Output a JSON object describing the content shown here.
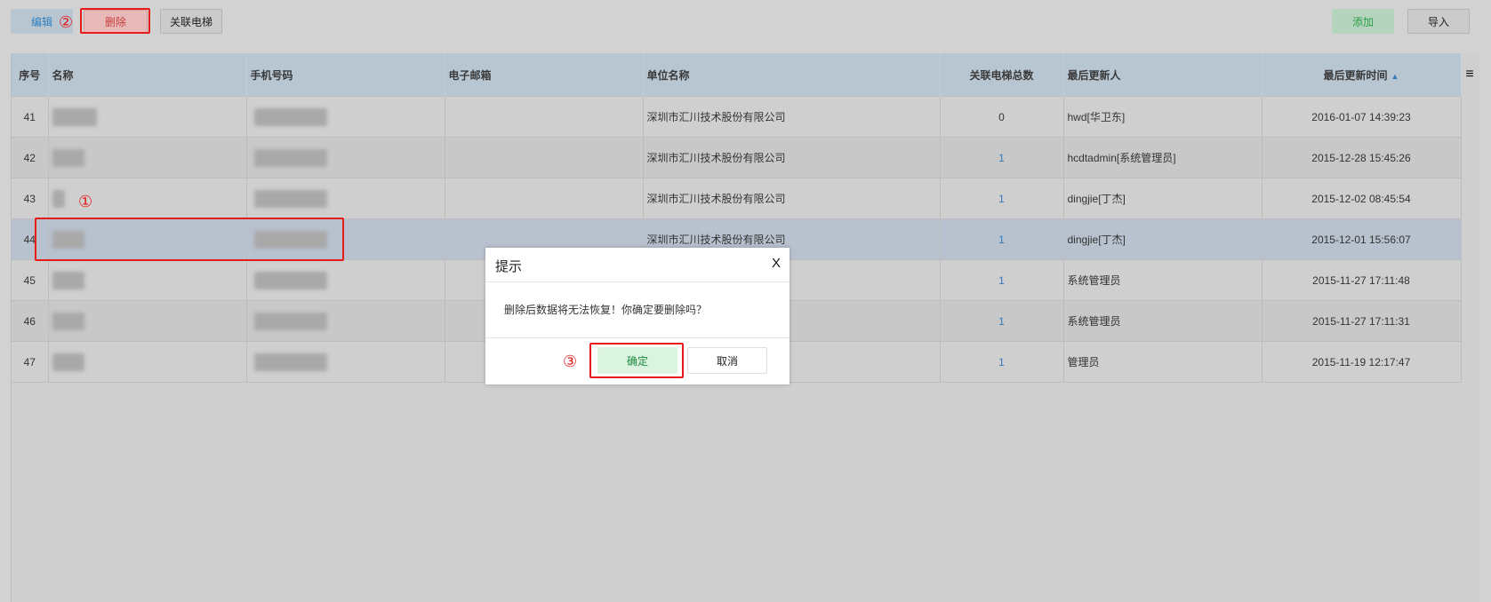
{
  "toolbar": {
    "edit_label": "编辑",
    "delete_label": "删除",
    "link_elevator_label": "关联电梯",
    "add_label": "添加",
    "import_label": "导入"
  },
  "colors": {
    "header_bg": "#b8c6d2",
    "link_blue": "#2f7bbd",
    "annotation_red": "#e81b1b",
    "confirm_green": "#1e8a3c"
  },
  "annotations": {
    "step1": "①",
    "step2": "②",
    "step3": "③"
  },
  "table": {
    "headers": {
      "index": "序号",
      "name": "名称",
      "phone": "手机号码",
      "email": "电子邮箱",
      "company": "单位名称",
      "elevator_count": "关联电梯总数",
      "last_updater": "最后更新人",
      "last_updated": "最后更新时间"
    },
    "sort_icon": "sort-icon",
    "rows": [
      {
        "index": "41",
        "email": "",
        "company": "深圳市汇川技术股份有限公司",
        "elevator_count": "0",
        "last_updater": "hwd[华卫东]",
        "last_updated": "2016-01-07 14:39:23"
      },
      {
        "index": "42",
        "email": "",
        "company": "深圳市汇川技术股份有限公司",
        "elevator_count": "1",
        "last_updater": "hcdtadmin[系统管理员]",
        "last_updated": "2015-12-28 15:45:26"
      },
      {
        "index": "43",
        "email": "",
        "company": "深圳市汇川技术股份有限公司",
        "elevator_count": "1",
        "last_updater": "dingjie[丁杰]",
        "last_updated": "2015-12-02 08:45:54"
      },
      {
        "index": "44",
        "email": "",
        "company": "深圳市汇川技术股份有限公司",
        "elevator_count": "1",
        "last_updater": "dingjie[丁杰]",
        "last_updated": "2015-12-01 15:56:07"
      },
      {
        "index": "45",
        "email": "",
        "company": "",
        "elevator_count": "1",
        "last_updater": "系统管理员",
        "last_updated": "2015-11-27 17:11:48"
      },
      {
        "index": "46",
        "email": "",
        "company": "",
        "elevator_count": "1",
        "last_updater": "系统管理员",
        "last_updated": "2015-11-27 17:11:31"
      },
      {
        "index": "47",
        "email": "",
        "company": "",
        "elevator_count": "1",
        "last_updater": "管理员",
        "last_updated": "2015-11-19 12:17:47"
      }
    ]
  },
  "dialog": {
    "title": "提示",
    "close": "X",
    "message": "删除后数据将无法恢复！你确定要删除吗？",
    "confirm_label": "确定",
    "cancel_label": "取消"
  }
}
